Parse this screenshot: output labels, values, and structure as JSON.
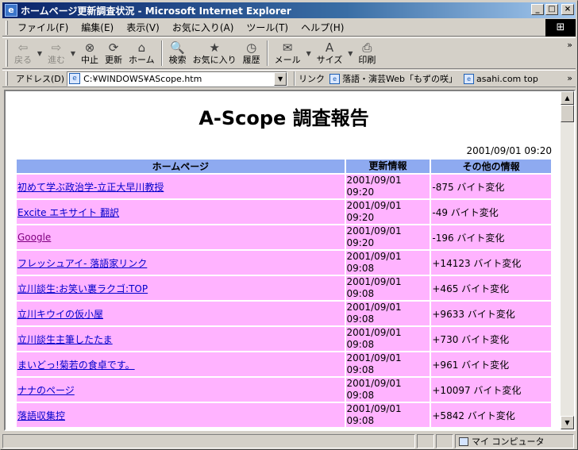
{
  "window": {
    "title": "ホームページ更新調査状況 - Microsoft Internet Explorer",
    "icon": "ie-page-icon",
    "buttons": [
      "minimize",
      "maximize",
      "close"
    ]
  },
  "menu": {
    "items": [
      "ファイル(F)",
      "編集(E)",
      "表示(V)",
      "お気に入り(A)",
      "ツール(T)",
      "ヘルプ(H)"
    ]
  },
  "toolbar": {
    "buttons": [
      {
        "label": "戻る",
        "icon": "back-arrow-icon",
        "glyph": "⇦",
        "disabled": true,
        "dropdown": true
      },
      {
        "label": "進む",
        "icon": "forward-arrow-icon",
        "glyph": "⇨",
        "disabled": true,
        "dropdown": true
      },
      {
        "label": "中止",
        "icon": "stop-icon",
        "glyph": "⊗",
        "disabled": false
      },
      {
        "label": "更新",
        "icon": "refresh-icon",
        "glyph": "⟳",
        "disabled": false
      },
      {
        "label": "ホーム",
        "icon": "home-icon",
        "glyph": "⌂",
        "disabled": false
      },
      {
        "label": "検索",
        "icon": "search-icon",
        "glyph": "🔍",
        "disabled": false
      },
      {
        "label": "お気に入り",
        "icon": "favorites-icon",
        "glyph": "★",
        "disabled": false
      },
      {
        "label": "履歴",
        "icon": "history-icon",
        "glyph": "◷",
        "disabled": false
      },
      {
        "label": "メール",
        "icon": "mail-icon",
        "glyph": "✉",
        "disabled": false,
        "dropdown": true
      },
      {
        "label": "サイズ",
        "icon": "text-size-icon",
        "glyph": "A",
        "disabled": false,
        "dropdown": true
      },
      {
        "label": "印刷",
        "icon": "print-icon",
        "glyph": "⎙",
        "disabled": false
      }
    ]
  },
  "address": {
    "label": "アドレス(D)",
    "value": "C:¥WINDOWS¥AScope.htm"
  },
  "links": {
    "label": "リンク",
    "items": [
      "落語・演芸Web「もずの咲」",
      "asahi.com top"
    ]
  },
  "page": {
    "title": "A-Scope 調査報告",
    "date": "2001/09/01 09:20",
    "headers": [
      "ホームページ",
      "更新情報",
      "その他の情報"
    ],
    "rows": [
      {
        "name": "初めて学ぶ政治学-立正大早川教授",
        "updated": [
          "2001/09/01",
          "09:20"
        ],
        "info": "-875 バイト変化",
        "visited": false
      },
      {
        "name": "Excite エキサイト 翻訳",
        "updated": [
          "2001/09/01",
          "09:20"
        ],
        "info": "-49 バイト変化",
        "visited": false
      },
      {
        "name": "Google",
        "updated": [
          "2001/09/01",
          "09:20"
        ],
        "info": "-196 バイト変化",
        "visited": true
      },
      {
        "name": "フレッシュアイ- 落語家リンク",
        "updated": [
          "2001/09/01",
          "09:08"
        ],
        "info": "+14123 バイト変化",
        "visited": false
      },
      {
        "name": "立川談生:お笑い裏ラクゴ:TOP",
        "updated": [
          "2001/09/01",
          "09:08"
        ],
        "info": "+465 バイト変化",
        "visited": false
      },
      {
        "name": "立川キウイの仮小屋",
        "updated": [
          "2001/09/01",
          "09:08"
        ],
        "info": "+9633 バイト変化",
        "visited": false
      },
      {
        "name": "立川談生主筆したたま",
        "updated": [
          "2001/09/01",
          "09:08"
        ],
        "info": "+730 バイト変化",
        "visited": false
      },
      {
        "name": "まいどっ!菊若の食卓です。",
        "updated": [
          "2001/09/01",
          "09:08"
        ],
        "info": "+961 バイト変化",
        "visited": false
      },
      {
        "name": "ナナのページ",
        "updated": [
          "2001/09/01",
          "09:08"
        ],
        "info": "+10097 バイト変化",
        "visited": false
      },
      {
        "name": "落語収集控",
        "updated": [
          "2001/09/01",
          "09:08"
        ],
        "info": "+5842 バイト変化",
        "visited": false
      }
    ]
  },
  "status": {
    "zone": "マイ コンピュータ"
  },
  "colors": {
    "header_bg": "#8eaaf0",
    "row_bg": "#ffb3ff",
    "link": "#0000cc",
    "visited_link": "#800080"
  }
}
